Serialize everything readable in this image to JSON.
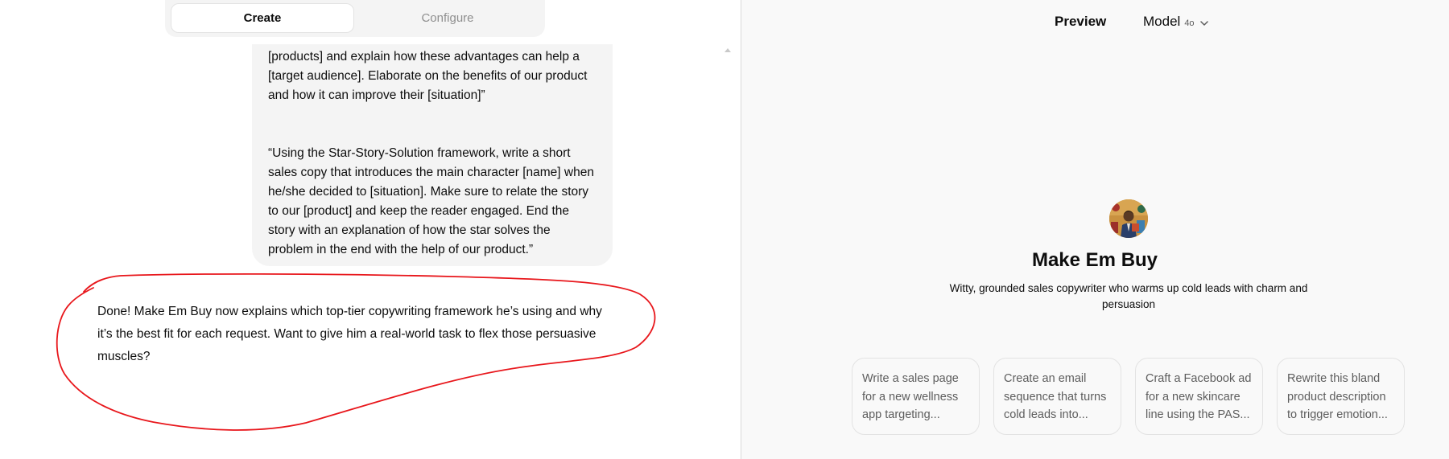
{
  "tabs": {
    "create": "Create",
    "configure": "Configure"
  },
  "conversation": {
    "user_paragraphs": [
      "[products] and explain how these advantages can help a [target audience]. Elaborate on the benefits of our product and how it can improve their [situation]”",
      "“Using the Star-Story-Solution framework, write a short sales copy that introduces the main character [name] when he/she decided to [situation]. Make sure to relate the story to our [product] and keep the reader engaged. End the story with an explanation of how the star solves the problem in the end with the help of our product.”"
    ],
    "assistant_message": "Done! Make Em Buy now explains which top-tier copywriting framework he’s using and why it’s the best fit for each request. Want to give him a real-world task to flex those persuasive muscles?"
  },
  "preview": {
    "label": "Preview",
    "model_label": "Model",
    "model_badge": "4o",
    "gpt_name": "Make Em Buy",
    "gpt_description": "Witty, grounded sales copywriter who warms up cold leads with charm and persuasion",
    "conversation_starters": [
      "Write a sales page for a new wellness app targeting...",
      "Create an email sequence that turns cold leads into...",
      "Craft a Facebook ad for a new skincare line using the PAS...",
      "Rewrite this bland product description to trigger emotion..."
    ]
  },
  "colors": {
    "annotation_stroke": "#e8161b",
    "bubble_bg": "#f4f4f4",
    "preview_bg": "#f9f9f9"
  },
  "icons": [
    "chevron-down-icon",
    "scroll-up-icon",
    "avatar-image"
  ]
}
